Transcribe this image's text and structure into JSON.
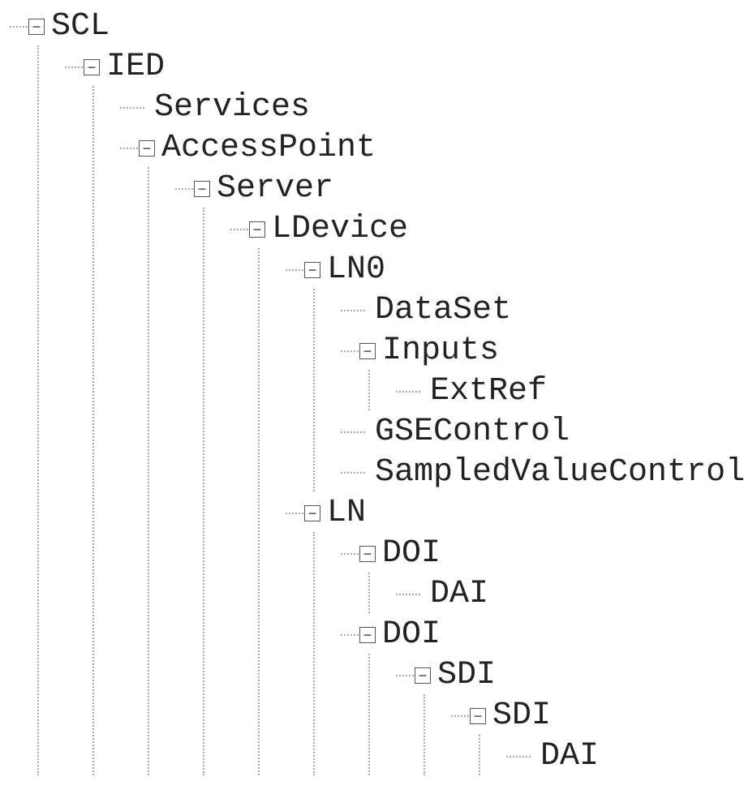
{
  "glyphs": {
    "minus": "−"
  },
  "tree": {
    "label": "SCL",
    "expandable": true,
    "expanded": true,
    "children": [
      {
        "label": "IED",
        "expandable": true,
        "expanded": true,
        "children": [
          {
            "label": "Services",
            "expandable": false
          },
          {
            "label": "AccessPoint",
            "expandable": true,
            "expanded": true,
            "children": [
              {
                "label": "Server",
                "expandable": true,
                "expanded": true,
                "children": [
                  {
                    "label": "LDevice",
                    "expandable": true,
                    "expanded": true,
                    "children": [
                      {
                        "label": "LN0",
                        "expandable": true,
                        "expanded": true,
                        "children": [
                          {
                            "label": "DataSet",
                            "expandable": false
                          },
                          {
                            "label": "Inputs",
                            "expandable": true,
                            "expanded": true,
                            "children": [
                              {
                                "label": "ExtRef",
                                "expandable": false
                              }
                            ]
                          },
                          {
                            "label": "GSEControl",
                            "expandable": false
                          },
                          {
                            "label": "SampledValueControl",
                            "expandable": false
                          }
                        ]
                      },
                      {
                        "label": "LN",
                        "expandable": true,
                        "expanded": true,
                        "children": [
                          {
                            "label": "DOI",
                            "expandable": true,
                            "expanded": true,
                            "children": [
                              {
                                "label": "DAI",
                                "expandable": false
                              }
                            ]
                          },
                          {
                            "label": "DOI",
                            "expandable": true,
                            "expanded": true,
                            "children": [
                              {
                                "label": "SDI",
                                "expandable": true,
                                "expanded": true,
                                "children": [
                                  {
                                    "label": "SDI",
                                    "expandable": true,
                                    "expanded": true,
                                    "children": [
                                      {
                                        "label": "DAI",
                                        "expandable": false
                                      }
                                    ]
                                  }
                                ]
                              }
                            ]
                          }
                        ]
                      }
                    ]
                  }
                ]
              }
            ]
          }
        ]
      }
    ]
  }
}
